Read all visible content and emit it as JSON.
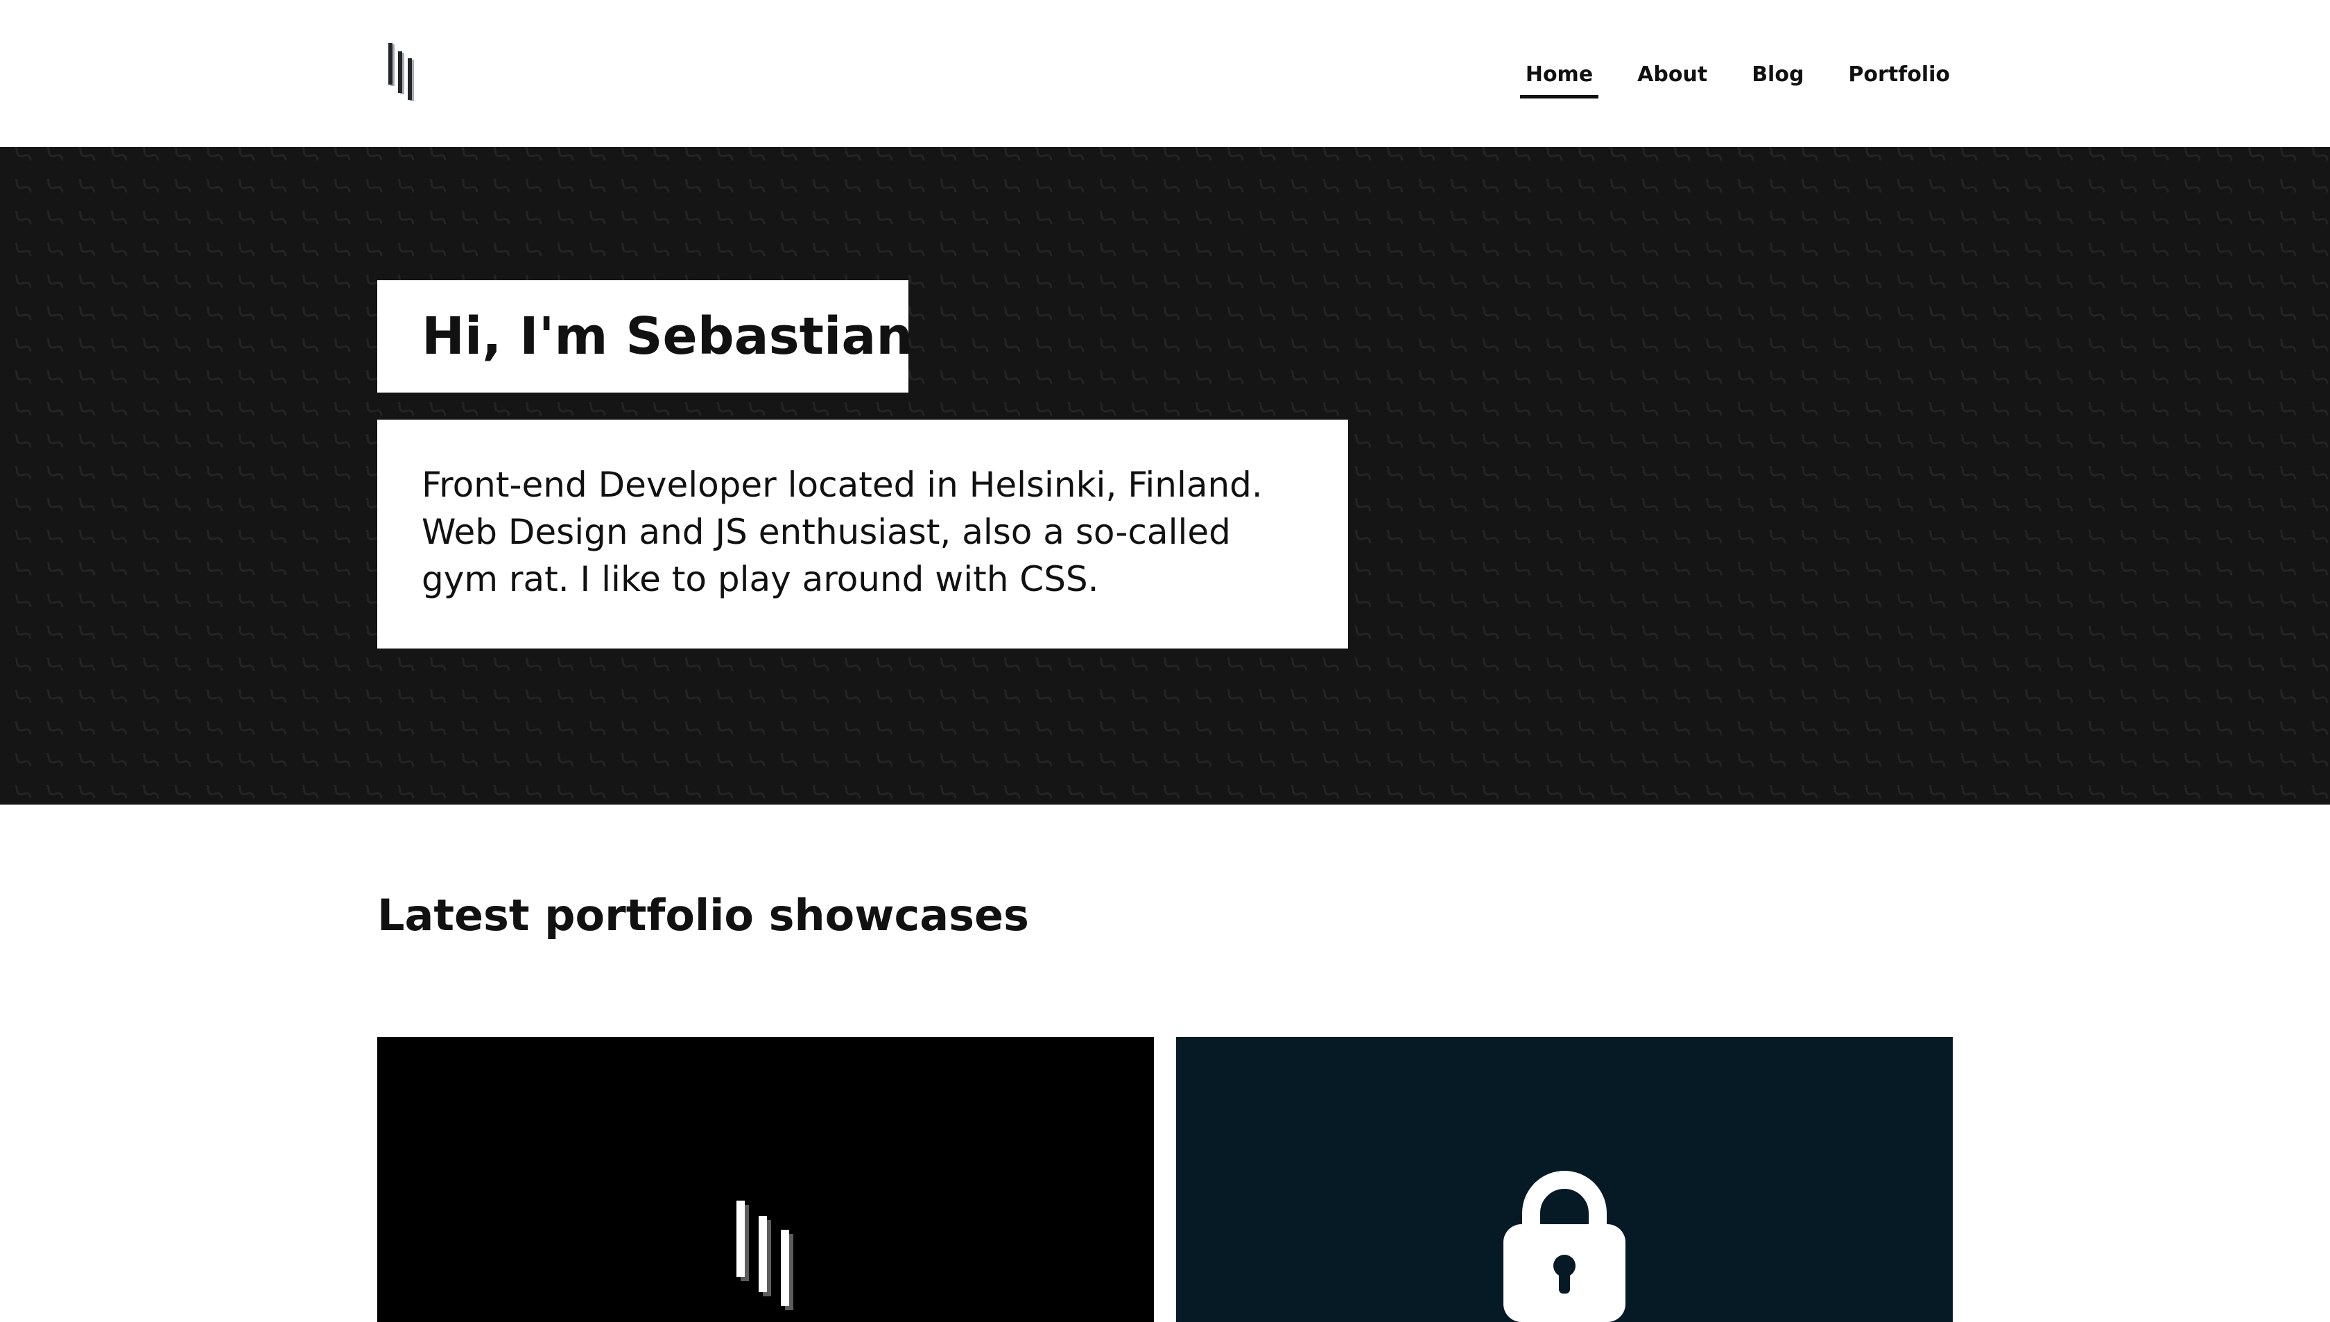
{
  "header": {
    "logo_icon": "stacked-bars-logo-icon",
    "nav": [
      {
        "label": "Home",
        "active": true
      },
      {
        "label": "About",
        "active": false
      },
      {
        "label": "Blog",
        "active": false
      },
      {
        "label": "Portfolio",
        "active": false
      }
    ]
  },
  "hero": {
    "title": "Hi, I'm Sebastian",
    "intro": "Front-end Developer located in Helsinki, Finland. Web Design and JS enthusiast, also a so-called gym rat. I like to play around with CSS.",
    "background_color": "#151515",
    "pattern_icon": "wavy-line-pattern"
  },
  "showcases": {
    "title": "Latest portfolio showcases",
    "cards": [
      {
        "icon": "stacked-bars-logo-icon",
        "background_color": "#000000"
      },
      {
        "icon": "padlock-icon",
        "background_color": "#061a26"
      }
    ]
  }
}
